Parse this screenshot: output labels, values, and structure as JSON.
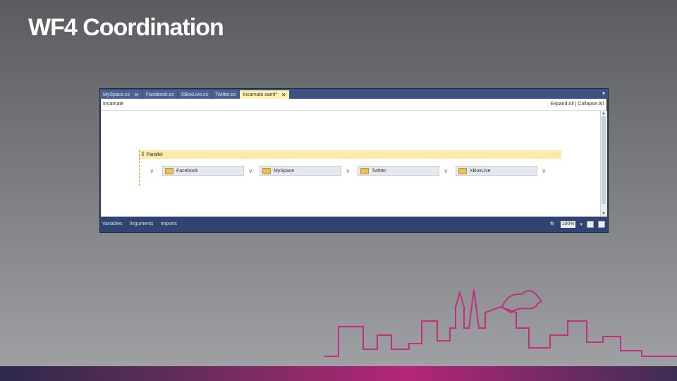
{
  "slide": {
    "title": "WF4 Coordination"
  },
  "tabs": [
    {
      "label": "MySpace.cs",
      "active": false
    },
    {
      "label": "Facebook.cs",
      "active": false
    },
    {
      "label": "XBoxLive.cs",
      "active": false
    },
    {
      "label": "Twitter.cs",
      "active": false
    },
    {
      "label": "Incarnate.xaml*",
      "active": true
    }
  ],
  "tab_menu_icon": "chevron-down-icon",
  "breadcrumb": {
    "current": "Incarnate",
    "expand_all": "Expand All",
    "collapse_all": "Collapse All"
  },
  "parallel": {
    "label": "Parallel",
    "branches": [
      "Facebook",
      "MySpace",
      "Twitter",
      "XBoxLive"
    ]
  },
  "statusbar": {
    "variables": "Variables",
    "arguments": "Arguments",
    "imports": "Imports",
    "zoom": "100%"
  },
  "colors": {
    "accent": "#b52677",
    "tab_active": "#fff2b0",
    "parallel_header": "#fde9a8"
  }
}
